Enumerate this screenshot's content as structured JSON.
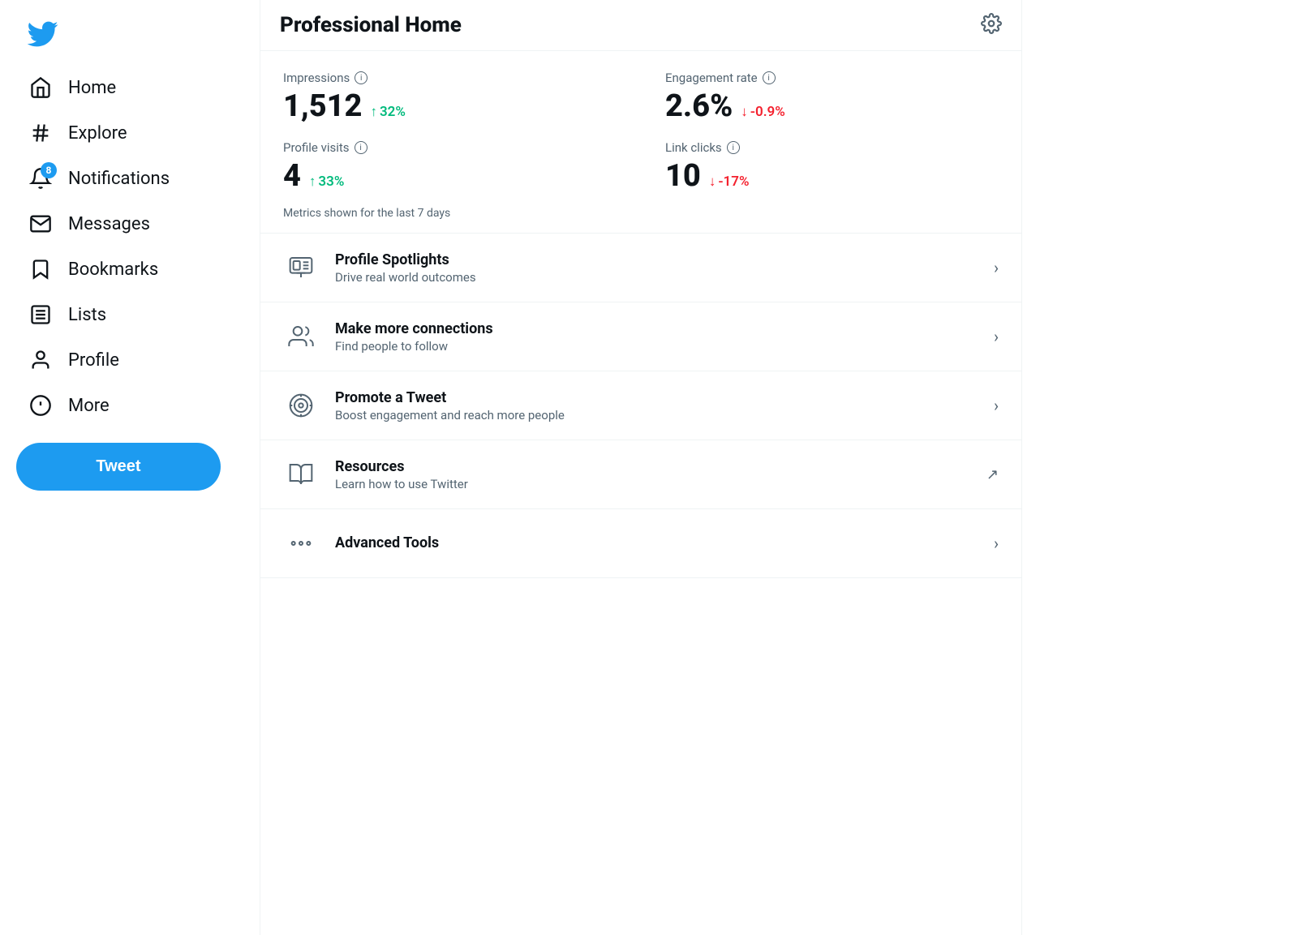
{
  "sidebar": {
    "logo_alt": "Twitter logo",
    "nav_items": [
      {
        "id": "home",
        "label": "Home",
        "icon": "home-icon"
      },
      {
        "id": "explore",
        "label": "Explore",
        "icon": "hashtag-icon"
      },
      {
        "id": "notifications",
        "label": "Notifications",
        "icon": "bell-icon",
        "badge": "8"
      },
      {
        "id": "messages",
        "label": "Messages",
        "icon": "mail-icon"
      },
      {
        "id": "bookmarks",
        "label": "Bookmarks",
        "icon": "bookmark-icon"
      },
      {
        "id": "lists",
        "label": "Lists",
        "icon": "lists-icon"
      },
      {
        "id": "profile",
        "label": "Profile",
        "icon": "profile-icon"
      },
      {
        "id": "more",
        "label": "More",
        "icon": "more-icon"
      }
    ],
    "tweet_button_label": "Tweet"
  },
  "header": {
    "title": "Professional Home",
    "settings_icon": "gear-icon"
  },
  "metrics": {
    "items": [
      {
        "id": "impressions",
        "label": "Impressions",
        "value": "1,512",
        "change": "32%",
        "change_direction": "up",
        "change_arrow": "↑"
      },
      {
        "id": "engagement_rate",
        "label": "Engagement rate",
        "value": "2.6%",
        "change": "-0.9%",
        "change_direction": "down",
        "change_arrow": "↓"
      },
      {
        "id": "profile_visits",
        "label": "Profile visits",
        "value": "4",
        "change": "33%",
        "change_direction": "up",
        "change_arrow": "↑"
      },
      {
        "id": "link_clicks",
        "label": "Link clicks",
        "value": "10",
        "change": "-17%",
        "change_direction": "down",
        "change_arrow": "↓"
      }
    ],
    "footer": "Metrics shown for the last 7 days"
  },
  "features": [
    {
      "id": "profile-spotlights",
      "icon": "spotlight-icon",
      "title": "Profile Spotlights",
      "subtitle": "Drive real world outcomes",
      "arrow": "›",
      "arrow_type": "chevron"
    },
    {
      "id": "make-connections",
      "icon": "connections-icon",
      "title": "Make more connections",
      "subtitle": "Find people to follow",
      "arrow": "›",
      "arrow_type": "chevron"
    },
    {
      "id": "promote-tweet",
      "icon": "promote-icon",
      "title": "Promote a Tweet",
      "subtitle": "Boost engagement and reach more people",
      "arrow": "›",
      "arrow_type": "chevron"
    },
    {
      "id": "resources",
      "icon": "resources-icon",
      "title": "Resources",
      "subtitle": "Learn how to use Twitter",
      "arrow": "↗",
      "arrow_type": "external"
    },
    {
      "id": "advanced-tools",
      "icon": "advanced-icon",
      "title": "Advanced Tools",
      "subtitle": "",
      "arrow": "›",
      "arrow_type": "chevron"
    }
  ]
}
